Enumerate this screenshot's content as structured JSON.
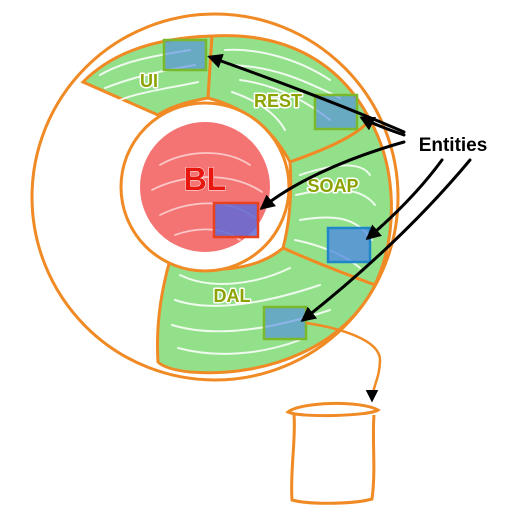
{
  "diagram": {
    "core_label": "BL",
    "segment_labels": {
      "ui": "UI",
      "rest": "REST",
      "soap": "SOAP",
      "dal": "DAL"
    },
    "callout_label": "Entities",
    "colors": {
      "outline": "#f08a24",
      "segment_fill": "#93e08a",
      "segment_scribble": "#ffffff",
      "core_fill": "#f47474",
      "core_text": "#e8170f",
      "segment_text": "#8aa300",
      "entity_fill": "#4b86e6",
      "entity_box_green": "#7ab82c",
      "entity_box_red": "#e8411e",
      "entity_box_blue": "#1f86c9",
      "callout_text": "#000000",
      "arrow": "#000000"
    }
  }
}
